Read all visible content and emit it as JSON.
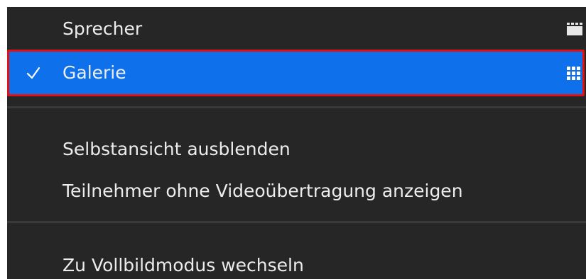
{
  "menu": {
    "items": [
      {
        "label": "Sprecher",
        "checked": false,
        "icon": "speaker-view-icon"
      },
      {
        "label": "Galerie",
        "checked": true,
        "icon": "gallery-view-icon"
      },
      {
        "label": "Selbstansicht ausblenden"
      },
      {
        "label": "Teilnehmer ohne Videoübertragung anzeigen"
      },
      {
        "label": "Zu Vollbildmodus wechseln"
      }
    ]
  },
  "colors": {
    "menu_background": "#262626",
    "selected_background": "#0e71eb",
    "highlight_border": "#e11212",
    "text": "#ececec"
  }
}
